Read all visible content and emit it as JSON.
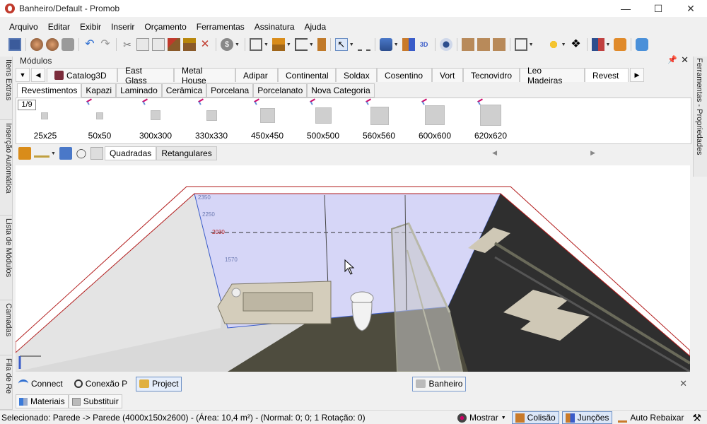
{
  "window": {
    "title": "Banheiro/Default - Promob",
    "controls": [
      "minimize",
      "maximize",
      "close"
    ]
  },
  "menu": [
    "Arquivo",
    "Editar",
    "Exibir",
    "Inserir",
    "Orçamento",
    "Ferramentas",
    "Assinatura",
    "Ajuda"
  ],
  "left_dock": [
    "Itens Extras",
    "Inserção Automática",
    "Lista de Módulos",
    "Camadas",
    "Fila de Re"
  ],
  "right_dock": [
    "Ferramentas - Propriedades"
  ],
  "modules": {
    "title": "Módulos",
    "library_tabs": [
      "Catalog3D",
      "East Glass",
      "Metal House",
      "Adipar",
      "Continental",
      "Soldax",
      "Cosentino",
      "Vort",
      "Tecnovidro",
      "Leo Madeiras",
      "Revest"
    ],
    "active_library": "Revest",
    "categories": [
      "Revestimentos",
      "Kapazi",
      "Laminado",
      "Cerâmica",
      "Porcelana",
      "Porcelanato",
      "Nova Categoria"
    ],
    "active_category": "Revestimentos",
    "page": "1/9",
    "items": [
      "25x25",
      "50x50",
      "300x300",
      "330x330",
      "450x450",
      "500x500",
      "560x560",
      "600x600",
      "620x620"
    ],
    "view_tabs": [
      "Quadradas",
      "Retangulares"
    ],
    "active_view_tab": "Quadradas"
  },
  "viewport": {
    "wall_labels": [
      "2350",
      "2250",
      "2030",
      "1570"
    ]
  },
  "doc_tabs": {
    "left": [
      "Connect",
      "Conexão P",
      "Project"
    ],
    "active_left": "Project",
    "center": "Banheiro"
  },
  "bottom_tabs": [
    "Materiais",
    "Substituir"
  ],
  "status": {
    "text": "Selecionado: Parede -> Parede (4000x150x2600) - (Área: 10,4 m²) - (Normal: 0; 0; 1 Rotação: 0)",
    "buttons": [
      "Mostrar",
      "Colisão",
      "Junções",
      "Auto Rebaixar"
    ],
    "active_buttons": [
      "Colisão",
      "Junções"
    ]
  },
  "colors": {
    "back_wall": "#d6d6f7",
    "floor": "#4e4c3e",
    "dark_wall": "#2f2f2f",
    "top_border": "#ffffff",
    "accent_red": "#b21b1b",
    "selection_blue": "#3a5cc9"
  }
}
